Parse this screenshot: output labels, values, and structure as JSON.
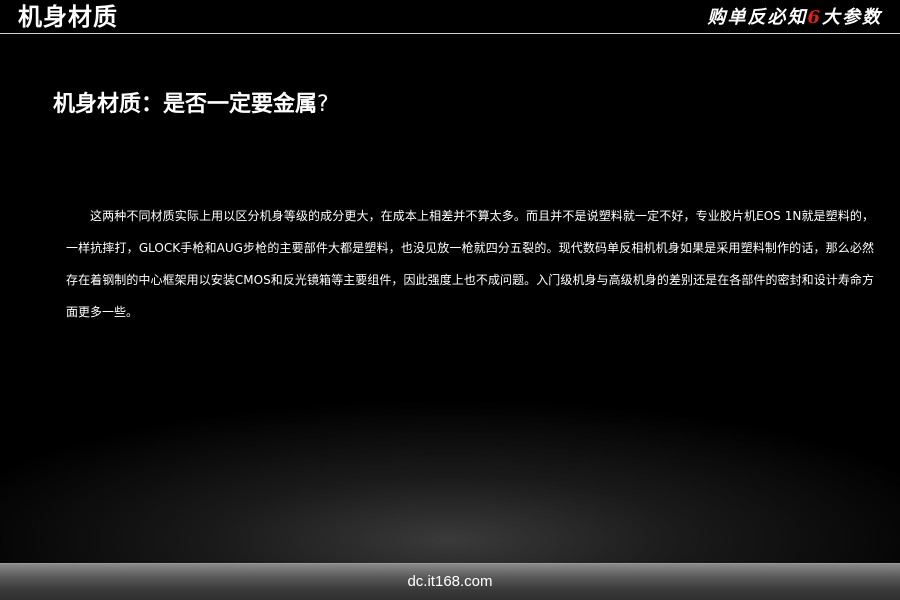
{
  "header": {
    "title": "机身材质",
    "slogan_before": "购单反必知",
    "slogan_number": "6",
    "slogan_after": "大参数"
  },
  "section": {
    "heading": "机身材质：是否一定要金属",
    "heading_qmark": "?",
    "paragraph": "这两种不同材质实际上用以区分机身等级的成分更大，在成本上相差并不算太多。而且并不是说塑料就一定不好，专业胶片机EOS 1N就是塑料的，一样抗摔打，GLOCK手枪和AUG步枪的主要部件大都是塑料，也没见放一枪就四分五裂的。现代数码单反相机机身如果是采用塑料制作的话，那么必然存在着钢制的中心框架用以安装CMOS和反光镜箱等主要组件，因此强度上也不成问题。入门级机身与高级机身的差别还是在各部件的密封和设计寿命方面更多一些。"
  },
  "footer": {
    "url": "dc.it168.com"
  },
  "colors": {
    "background": "#000000",
    "text": "#ffffff",
    "accent": "#e0201c",
    "footer_bar": "#5a5a5a"
  }
}
